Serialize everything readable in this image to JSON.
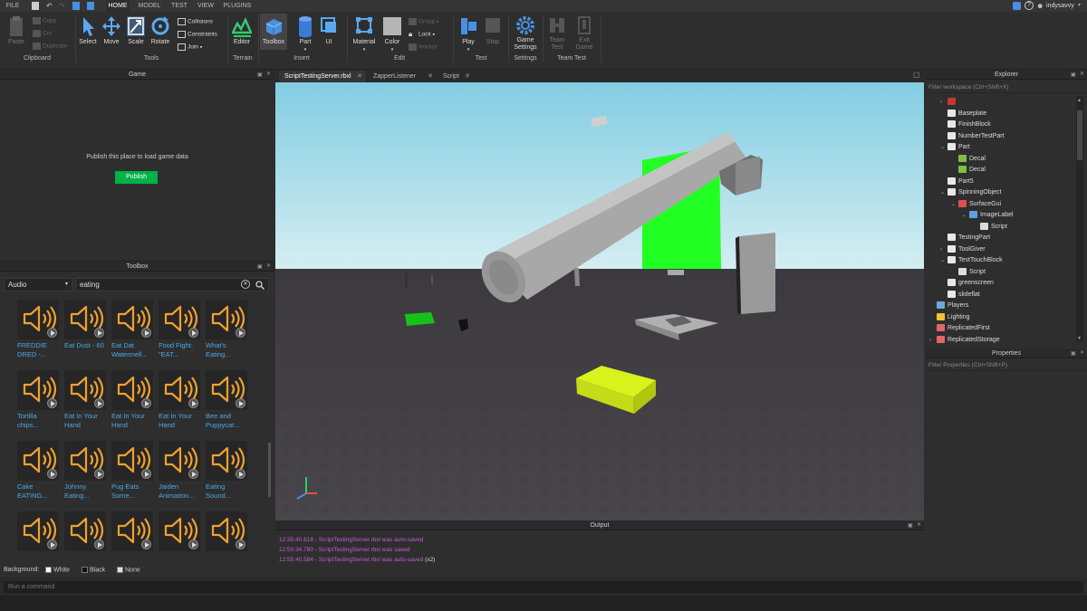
{
  "menu": {
    "file": "FILE",
    "tabs": [
      "HOME",
      "MODEL",
      "TEST",
      "VIEW",
      "PLUGINS"
    ],
    "user": "indysavvy"
  },
  "ribbon": {
    "clipboard": {
      "paste": "Paste",
      "copy": "Copy",
      "cut": "Cut",
      "duplicate": "Duplicate",
      "group": "Clipboard"
    },
    "tools": {
      "select": "Select",
      "move": "Move",
      "scale": "Scale",
      "rotate": "Rotate",
      "collisions": "Collisions",
      "constraints": "Constraints",
      "join": "Join",
      "group": "Tools"
    },
    "terrain": {
      "editor": "Editor",
      "group": "Terrain"
    },
    "insert": {
      "toolbox": "Toolbox",
      "part": "Part",
      "ui": "UI",
      "group": "Insert"
    },
    "edit": {
      "material": "Material",
      "color": "Color",
      "group_btn": "Group",
      "lock": "Lock",
      "anchor": "Anchor",
      "group": "Edit"
    },
    "test": {
      "play": "Play",
      "stop": "Stop",
      "group": "Test"
    },
    "settings": {
      "game_settings_1": "Game",
      "game_settings_2": "Settings",
      "group": "Settings"
    },
    "team_test": {
      "team_test_1": "Team",
      "team_test_2": "Test",
      "exit_game_1": "Exit",
      "exit_game_2": "Game",
      "group": "Team Test"
    }
  },
  "game_panel": {
    "title": "Game",
    "message": "Publish this place to load game data",
    "publish_button": "Publish"
  },
  "toolbox": {
    "title": "Toolbox",
    "category": "Audio",
    "search_value": "eating",
    "items": [
      [
        "FREDDIE",
        "DRED -..."
      ],
      [
        "Eat Dust - 60",
        ""
      ],
      [
        "Eat Dat",
        "Watermell..."
      ],
      [
        "Food Fight:",
        "\"EAT..."
      ],
      [
        "What's",
        "Eating..."
      ],
      [
        "Tortilla",
        "chips..."
      ],
      [
        "Eat In Your",
        "Hand"
      ],
      [
        "Eat In Your",
        "Hand"
      ],
      [
        "Eat In Your",
        "Hand"
      ],
      [
        "Bee and",
        "Puppycat..."
      ],
      [
        "Cake",
        "EATING..."
      ],
      [
        "Johnny",
        "Eating..."
      ],
      [
        "Pug Eats",
        "Some..."
      ],
      [
        "Jaiden",
        "Animation..."
      ],
      [
        "Eating",
        "Sound..."
      ],
      [
        "",
        ""
      ],
      [
        "",
        ""
      ],
      [
        "",
        ""
      ],
      [
        "",
        ""
      ],
      [
        "",
        ""
      ]
    ],
    "background_label": "Background:",
    "background_options": [
      "White",
      "Black",
      "None"
    ]
  },
  "doc_tabs": [
    "ScriptTestingServer.rbxl",
    "ZapperListener",
    "Script"
  ],
  "output": {
    "title": "Output",
    "lines": [
      {
        "text": "12:35:40.618 - ScriptTestingServer.rbxl was auto-saved",
        "suffix": ""
      },
      {
        "text": "12:50:34.780 - ScriptTestingServer.rbxl was saved",
        "suffix": ""
      },
      {
        "text": "12:55:40.584 - ScriptTestingServer.rbxl was auto-saved",
        "suffix": " (x2)"
      }
    ]
  },
  "explorer": {
    "title": "Explorer",
    "filter_placeholder": "Filter workspace (Ctrl+Shift+X)",
    "items": [
      {
        "label": "",
        "depth": 2,
        "arrow": "›",
        "icon": "#c0392b"
      },
      {
        "label": "Baseplate",
        "depth": 2,
        "arrow": "",
        "icon": "#e8e8e8"
      },
      {
        "label": "FinishBlock",
        "depth": 2,
        "arrow": "",
        "icon": "#e8e8e8"
      },
      {
        "label": "NumberTestPart",
        "depth": 2,
        "arrow": "",
        "icon": "#e8e8e8"
      },
      {
        "label": "Part",
        "depth": 2,
        "arrow": "⌄",
        "icon": "#e8e8e8"
      },
      {
        "label": "Decal",
        "depth": 3,
        "arrow": "",
        "icon": "#7fbf3f"
      },
      {
        "label": "Decal",
        "depth": 3,
        "arrow": "",
        "icon": "#7fbf3f"
      },
      {
        "label": "Part5",
        "depth": 2,
        "arrow": "",
        "icon": "#e8e8e8"
      },
      {
        "label": "SpinningObject",
        "depth": 2,
        "arrow": "⌄",
        "icon": "#e8e8e8"
      },
      {
        "label": "SurfaceGui",
        "depth": 3,
        "arrow": "⌄",
        "icon": "#e05050"
      },
      {
        "label": "ImageLabel",
        "depth": 4,
        "arrow": "⌄",
        "icon": "#5fa0e0"
      },
      {
        "label": "Script",
        "depth": 5,
        "arrow": "",
        "icon": "#dcdcdc"
      },
      {
        "label": "TestingPart",
        "depth": 2,
        "arrow": "",
        "icon": "#e8e8e8"
      },
      {
        "label": "ToolGiver",
        "depth": 2,
        "arrow": "›",
        "icon": "#e8e8e8"
      },
      {
        "label": "TestTouchBlock",
        "depth": 2,
        "arrow": "⌄",
        "icon": "#e8e8e8"
      },
      {
        "label": "Script",
        "depth": 3,
        "arrow": "",
        "icon": "#dcdcdc"
      },
      {
        "label": "greenscreen",
        "depth": 2,
        "arrow": "",
        "icon": "#e8e8e8"
      },
      {
        "label": "slideflat",
        "depth": 2,
        "arrow": "",
        "icon": "#e8e8e8"
      },
      {
        "label": "Players",
        "depth": 1,
        "arrow": "",
        "icon": "#6fa8dc"
      },
      {
        "label": "Lighting",
        "depth": 1,
        "arrow": "",
        "icon": "#f1c232"
      },
      {
        "label": "ReplicatedFirst",
        "depth": 1,
        "arrow": "",
        "icon": "#e06666"
      },
      {
        "label": "ReplicatedStorage",
        "depth": 1,
        "arrow": "›",
        "icon": "#e06666"
      }
    ]
  },
  "properties": {
    "title": "Properties",
    "filter_placeholder": "Filter Properties (Ctrl+Shift+P)"
  },
  "command_bar": {
    "placeholder": "Run a command"
  },
  "colors": {
    "publish": "#00b248",
    "sky": "#8fd3e4",
    "ground": "#434046",
    "green_part": "#22ff22",
    "lime_part": "#d8f21c",
    "link": "#4aa8e8",
    "output_text": "#c45dd6"
  }
}
